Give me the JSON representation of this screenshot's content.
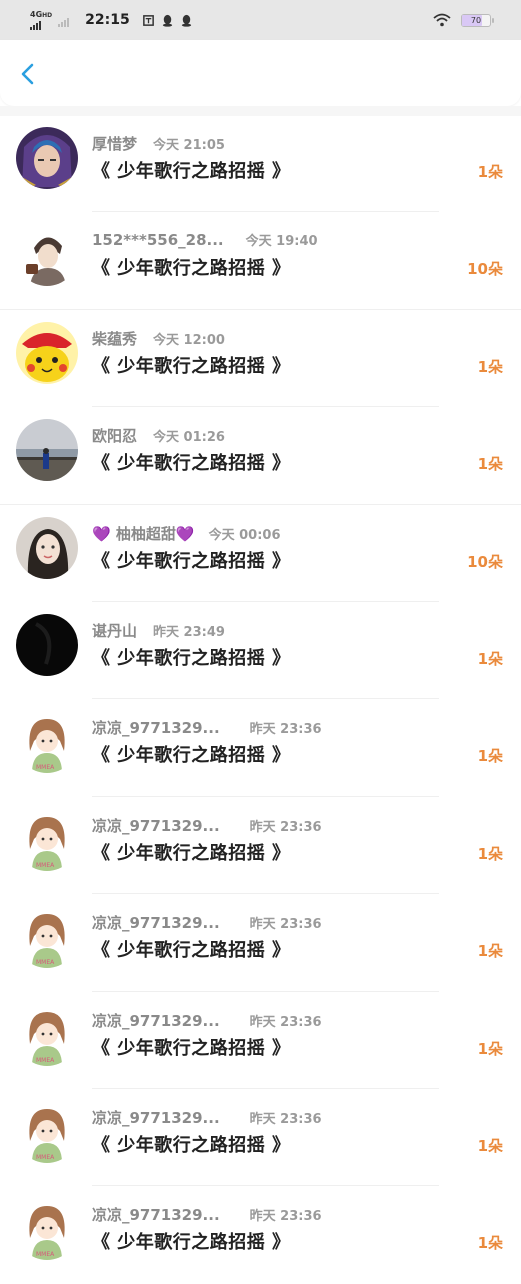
{
  "status_bar": {
    "network_top": "4G",
    "network_sup": "HD",
    "time": "22:15",
    "battery": "70"
  },
  "header": {
    "back_icon": "chevron-left-icon"
  },
  "rows": [
    {
      "name": "厚惜梦",
      "time": "今天 21:05",
      "title": "《 少年歌行之路招摇 》",
      "count": "1朵",
      "avatar": "anime"
    },
    {
      "name": "152***556_28...",
      "time": "今天 19:40",
      "title": "《 少年歌行之路招摇 》",
      "count": "10朵",
      "avatar": "sketch"
    },
    {
      "name": "柴蕴秀",
      "time": "今天 12:00",
      "title": "《 少年歌行之路招摇 》",
      "count": "1朵",
      "avatar": "pikachu"
    },
    {
      "name": "欧阳忍",
      "time": "今天 01:26",
      "title": "《 少年歌行之路招摇 》",
      "count": "1朵",
      "avatar": "lake"
    },
    {
      "name": "💜 柚柚超甜💜",
      "time": "今天 00:06",
      "title": "《 少年歌行之路招摇 》",
      "count": "10朵",
      "avatar": "girl"
    },
    {
      "name": "谌丹山",
      "time": "昨天 23:49",
      "title": "《 少年歌行之路招摇 》",
      "count": "1朵",
      "avatar": "black"
    },
    {
      "name": "凉凉_9771329...",
      "time": "昨天 23:36",
      "title": "《 少年歌行之路招摇 》",
      "count": "1朵",
      "avatar": "cartoon"
    },
    {
      "name": "凉凉_9771329...",
      "time": "昨天 23:36",
      "title": "《 少年歌行之路招摇 》",
      "count": "1朵",
      "avatar": "cartoon"
    },
    {
      "name": "凉凉_9771329...",
      "time": "昨天 23:36",
      "title": "《 少年歌行之路招摇 》",
      "count": "1朵",
      "avatar": "cartoon"
    },
    {
      "name": "凉凉_9771329...",
      "time": "昨天 23:36",
      "title": "《 少年歌行之路招摇 》",
      "count": "1朵",
      "avatar": "cartoon"
    },
    {
      "name": "凉凉_9771329...",
      "time": "昨天 23:36",
      "title": "《 少年歌行之路招摇 》",
      "count": "1朵",
      "avatar": "cartoon"
    },
    {
      "name": "凉凉_9771329...",
      "time": "昨天 23:36",
      "title": "《 少年歌行之路招摇 》",
      "count": "1朵",
      "avatar": "cartoon"
    }
  ],
  "colors": {
    "accent": "#ea8a3c",
    "back": "#2a9fe0",
    "name": "#8a8a8a"
  }
}
